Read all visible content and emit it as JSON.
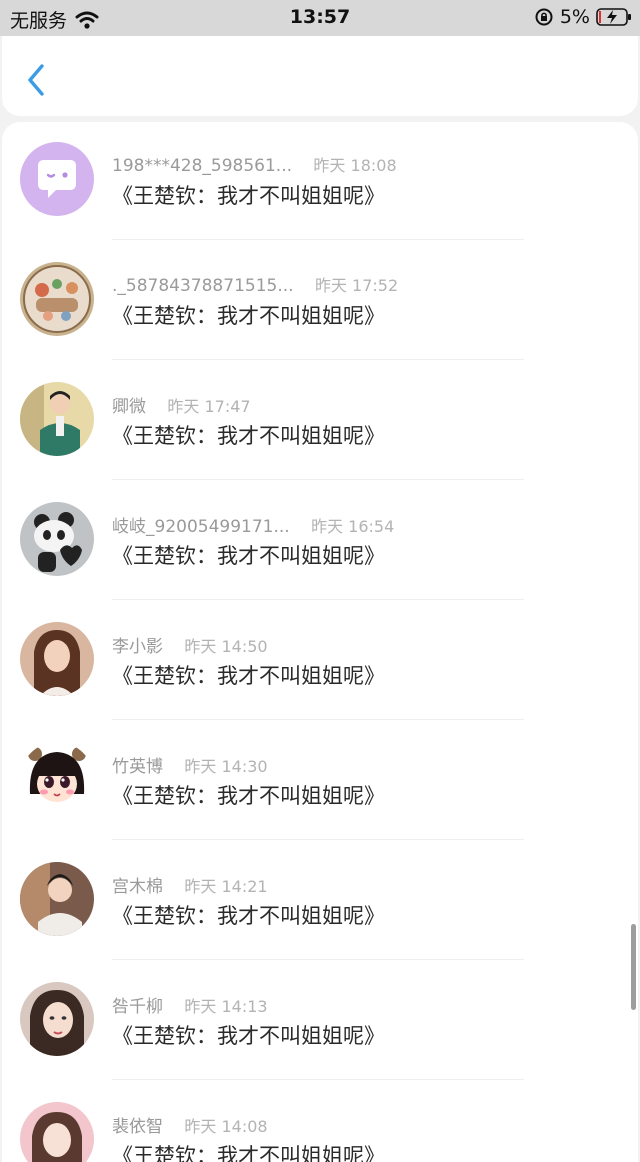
{
  "status_bar": {
    "carrier": "无服务",
    "time": "13:57",
    "battery_percent": "5%",
    "wifi_icon": "wifi-icon",
    "rotation_lock_icon": "rotation-lock-icon",
    "battery_icon": "battery-charging-icon"
  },
  "header": {
    "back_icon": "chevron-left-icon",
    "accent_color": "#3a9ce6"
  },
  "list": {
    "items": [
      {
        "username": "198***428_598561...",
        "time": "昨天 18:08",
        "content": "《王楚钦：我才不叫姐姐呢》",
        "avatar": "purple-chat-bubble-avatar"
      },
      {
        "username": "._58784378871515...",
        "time": "昨天 17:52",
        "content": "《王楚钦：我才不叫姐姐呢》",
        "avatar": "cartoon-illustration-avatar"
      },
      {
        "username": "卿微",
        "time": "昨天 17:47",
        "content": "《王楚钦：我才不叫姐姐呢》",
        "avatar": "man-green-coat-avatar"
      },
      {
        "username": "岐岐_92005499171...",
        "time": "昨天 16:54",
        "content": "《王楚钦：我才不叫姐姐呢》",
        "avatar": "panda-heart-avatar"
      },
      {
        "username": "李小影",
        "time": "昨天 14:50",
        "content": "《王楚钦：我才不叫姐姐呢》",
        "avatar": "woman-portrait-avatar"
      },
      {
        "username": "竹英博",
        "time": "昨天 14:30",
        "content": "《王楚钦：我才不叫姐姐呢》",
        "avatar": "cartoon-girl-avatar"
      },
      {
        "username": "宫木棉",
        "time": "昨天 14:21",
        "content": "《王楚钦：我才不叫姐姐呢》",
        "avatar": "man-portrait-avatar"
      },
      {
        "username": "咎千柳",
        "time": "昨天 14:13",
        "content": "《王楚钦：我才不叫姐姐呢》",
        "avatar": "woman-selfie-avatar"
      },
      {
        "username": "裴依智",
        "time": "昨天 14:08",
        "content": "《王楚钦：我才不叫姐姐呢》",
        "avatar": "woman-pink-avatar"
      }
    ]
  }
}
